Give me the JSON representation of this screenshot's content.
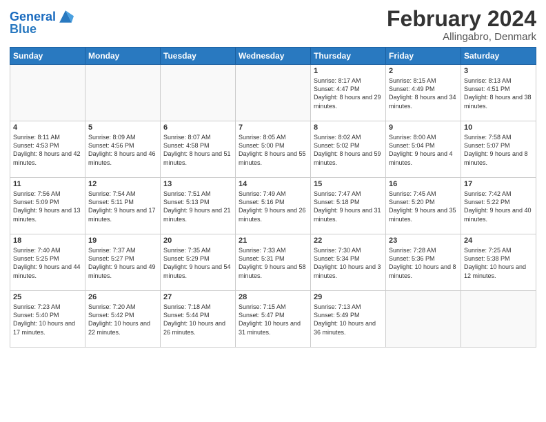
{
  "header": {
    "logo_line1": "General",
    "logo_line2": "Blue",
    "month": "February 2024",
    "location": "Allingabro, Denmark"
  },
  "weekdays": [
    "Sunday",
    "Monday",
    "Tuesday",
    "Wednesday",
    "Thursday",
    "Friday",
    "Saturday"
  ],
  "weeks": [
    [
      {
        "day": "",
        "info": "",
        "empty": true
      },
      {
        "day": "",
        "info": "",
        "empty": true
      },
      {
        "day": "",
        "info": "",
        "empty": true
      },
      {
        "day": "",
        "info": "",
        "empty": true
      },
      {
        "day": "1",
        "info": "Sunrise: 8:17 AM\nSunset: 4:47 PM\nDaylight: 8 hours and 29 minutes."
      },
      {
        "day": "2",
        "info": "Sunrise: 8:15 AM\nSunset: 4:49 PM\nDaylight: 8 hours and 34 minutes."
      },
      {
        "day": "3",
        "info": "Sunrise: 8:13 AM\nSunset: 4:51 PM\nDaylight: 8 hours and 38 minutes."
      }
    ],
    [
      {
        "day": "4",
        "info": "Sunrise: 8:11 AM\nSunset: 4:53 PM\nDaylight: 8 hours and 42 minutes."
      },
      {
        "day": "5",
        "info": "Sunrise: 8:09 AM\nSunset: 4:56 PM\nDaylight: 8 hours and 46 minutes."
      },
      {
        "day": "6",
        "info": "Sunrise: 8:07 AM\nSunset: 4:58 PM\nDaylight: 8 hours and 51 minutes."
      },
      {
        "day": "7",
        "info": "Sunrise: 8:05 AM\nSunset: 5:00 PM\nDaylight: 8 hours and 55 minutes."
      },
      {
        "day": "8",
        "info": "Sunrise: 8:02 AM\nSunset: 5:02 PM\nDaylight: 8 hours and 59 minutes."
      },
      {
        "day": "9",
        "info": "Sunrise: 8:00 AM\nSunset: 5:04 PM\nDaylight: 9 hours and 4 minutes."
      },
      {
        "day": "10",
        "info": "Sunrise: 7:58 AM\nSunset: 5:07 PM\nDaylight: 9 hours and 8 minutes."
      }
    ],
    [
      {
        "day": "11",
        "info": "Sunrise: 7:56 AM\nSunset: 5:09 PM\nDaylight: 9 hours and 13 minutes."
      },
      {
        "day": "12",
        "info": "Sunrise: 7:54 AM\nSunset: 5:11 PM\nDaylight: 9 hours and 17 minutes."
      },
      {
        "day": "13",
        "info": "Sunrise: 7:51 AM\nSunset: 5:13 PM\nDaylight: 9 hours and 21 minutes."
      },
      {
        "day": "14",
        "info": "Sunrise: 7:49 AM\nSunset: 5:16 PM\nDaylight: 9 hours and 26 minutes."
      },
      {
        "day": "15",
        "info": "Sunrise: 7:47 AM\nSunset: 5:18 PM\nDaylight: 9 hours and 31 minutes."
      },
      {
        "day": "16",
        "info": "Sunrise: 7:45 AM\nSunset: 5:20 PM\nDaylight: 9 hours and 35 minutes."
      },
      {
        "day": "17",
        "info": "Sunrise: 7:42 AM\nSunset: 5:22 PM\nDaylight: 9 hours and 40 minutes."
      }
    ],
    [
      {
        "day": "18",
        "info": "Sunrise: 7:40 AM\nSunset: 5:25 PM\nDaylight: 9 hours and 44 minutes."
      },
      {
        "day": "19",
        "info": "Sunrise: 7:37 AM\nSunset: 5:27 PM\nDaylight: 9 hours and 49 minutes."
      },
      {
        "day": "20",
        "info": "Sunrise: 7:35 AM\nSunset: 5:29 PM\nDaylight: 9 hours and 54 minutes."
      },
      {
        "day": "21",
        "info": "Sunrise: 7:33 AM\nSunset: 5:31 PM\nDaylight: 9 hours and 58 minutes."
      },
      {
        "day": "22",
        "info": "Sunrise: 7:30 AM\nSunset: 5:34 PM\nDaylight: 10 hours and 3 minutes."
      },
      {
        "day": "23",
        "info": "Sunrise: 7:28 AM\nSunset: 5:36 PM\nDaylight: 10 hours and 8 minutes."
      },
      {
        "day": "24",
        "info": "Sunrise: 7:25 AM\nSunset: 5:38 PM\nDaylight: 10 hours and 12 minutes."
      }
    ],
    [
      {
        "day": "25",
        "info": "Sunrise: 7:23 AM\nSunset: 5:40 PM\nDaylight: 10 hours and 17 minutes."
      },
      {
        "day": "26",
        "info": "Sunrise: 7:20 AM\nSunset: 5:42 PM\nDaylight: 10 hours and 22 minutes."
      },
      {
        "day": "27",
        "info": "Sunrise: 7:18 AM\nSunset: 5:44 PM\nDaylight: 10 hours and 26 minutes."
      },
      {
        "day": "28",
        "info": "Sunrise: 7:15 AM\nSunset: 5:47 PM\nDaylight: 10 hours and 31 minutes."
      },
      {
        "day": "29",
        "info": "Sunrise: 7:13 AM\nSunset: 5:49 PM\nDaylight: 10 hours and 36 minutes."
      },
      {
        "day": "",
        "info": "",
        "empty": true
      },
      {
        "day": "",
        "info": "",
        "empty": true
      }
    ]
  ]
}
